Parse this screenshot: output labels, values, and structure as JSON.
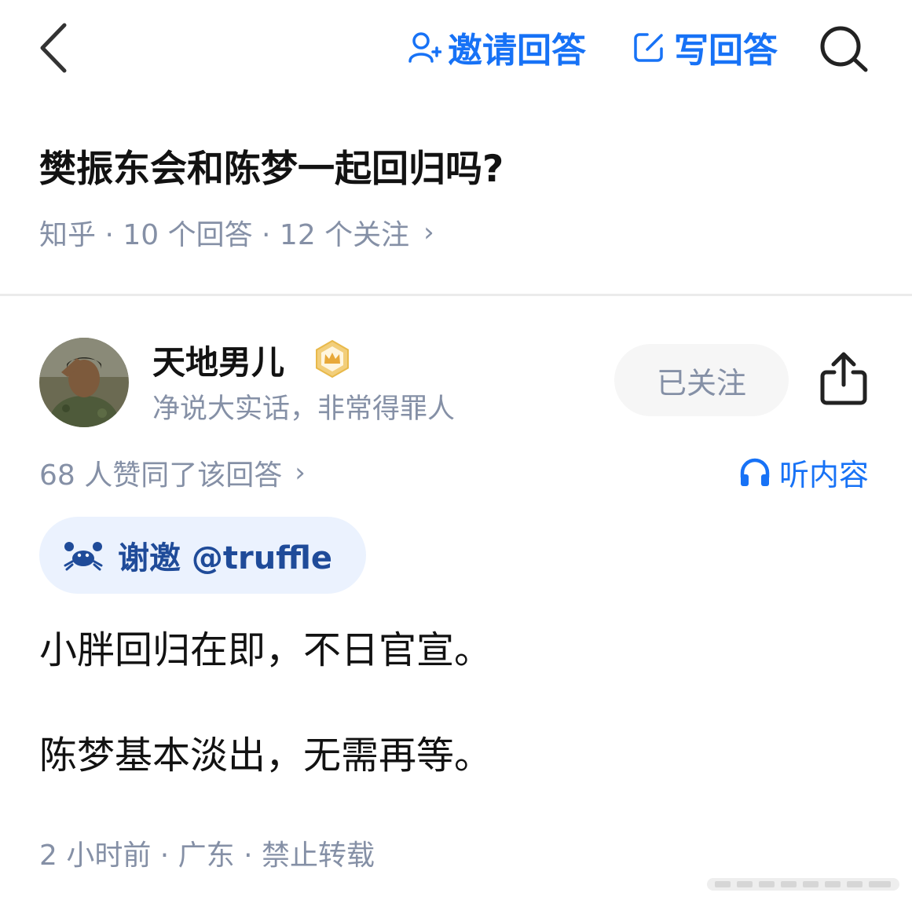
{
  "topbar": {
    "invite_label": "邀请回答",
    "write_label": "写回答"
  },
  "question": {
    "title": "樊振东会和陈梦一起回归吗?",
    "meta": "知乎 · 10 个回答 · 12 个关注"
  },
  "author": {
    "name": "天地男儿",
    "bio": "净说大实话，非常得罪人",
    "follow_label": "已关注"
  },
  "answer": {
    "votes_text": "68 人赞同了该回答",
    "listen_label": "听内容",
    "thanks_text": "谢邀 @truffle",
    "paragraphs": [
      "小胖回归在即，不日官宣。",
      "陈梦基本淡出，无需再等。"
    ],
    "footer_meta": "2 小时前 · 广东 · 禁止转载"
  },
  "icons": {
    "back": "chevron-left-icon",
    "invite": "person-plus-icon",
    "write": "edit-icon",
    "search": "search-icon",
    "badge": "crown-badge-icon",
    "share": "share-icon",
    "listen": "headphones-icon",
    "thanks": "crab-icon",
    "chevron": "chevron-right-icon"
  },
  "colors": {
    "accent": "#1772f6",
    "muted_text": "#8590a6",
    "chip_bg": "#ebf2fe",
    "chip_text": "#1f4b99",
    "badge_gold": "#e8b94a"
  }
}
